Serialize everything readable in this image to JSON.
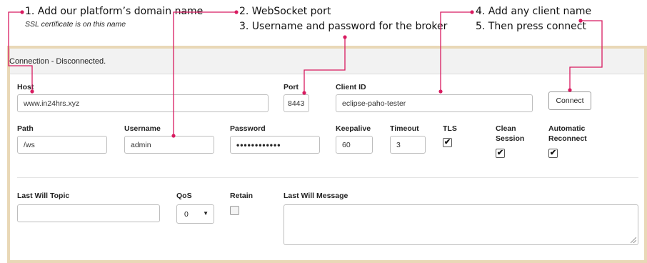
{
  "annotations": {
    "step1": "1. Add our platform’s domain name",
    "step1_note": "SSL certificate is on this name",
    "step2": "2. WebSocket port",
    "step3": "3. Username and password for the broker",
    "step4": "4. Add any client name",
    "step5": "5. Then press connect",
    "pointer_color": "#d81b60"
  },
  "connection": {
    "status": "Connection - Disconnected."
  },
  "fields": {
    "host_label": "Host",
    "host_value": "www.in24hrs.xyz",
    "port_label": "Port",
    "port_value": "8443",
    "client_id_label": "Client ID",
    "client_id_value": "eclipse-paho-tester",
    "connect_label": "Connect",
    "path_label": "Path",
    "path_value": "/ws",
    "username_label": "Username",
    "username_value": "admin",
    "password_label": "Password",
    "password_value": "••••••••••••",
    "keepalive_label": "Keepalive",
    "keepalive_value": "60",
    "timeout_label": "Timeout",
    "timeout_value": "3",
    "tls_label": "TLS",
    "tls_checked": true,
    "clean_session_label_1": "Clean",
    "clean_session_label_2": "Session",
    "clean_session_checked": true,
    "auto_reconnect_label_1": "Automatic",
    "auto_reconnect_label_2": "Reconnect",
    "auto_reconnect_checked": true
  },
  "last_will": {
    "topic_label": "Last Will Topic",
    "topic_value": "",
    "qos_label": "QoS",
    "qos_value": "0",
    "retain_label": "Retain",
    "retain_checked": false,
    "message_label": "Last Will Message",
    "message_value": ""
  },
  "check_glyph": "✔"
}
